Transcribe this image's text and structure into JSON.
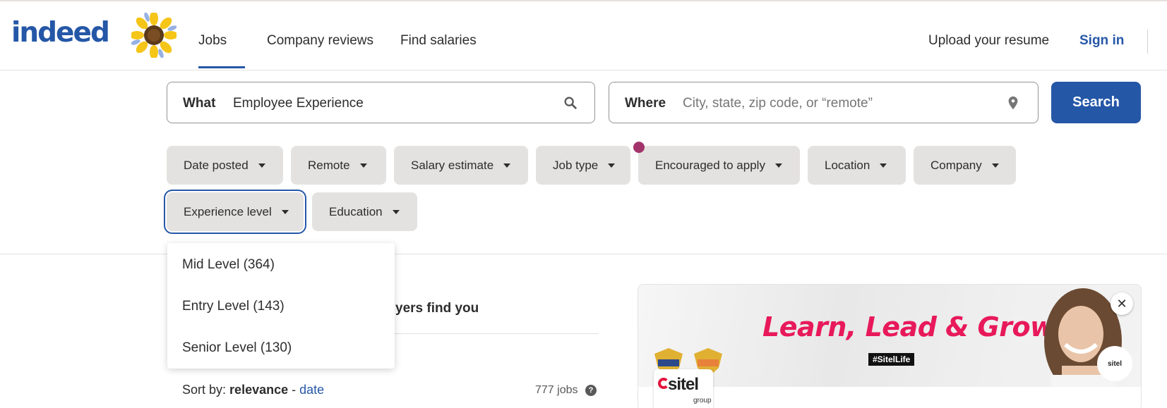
{
  "header": {
    "logo_text": "indeed",
    "nav": {
      "jobs": "Jobs",
      "company_reviews": "Company reviews",
      "find_salaries": "Find salaries"
    },
    "upload_resume": "Upload your resume",
    "sign_in": "Sign in"
  },
  "search": {
    "what_label": "What",
    "what_value": "Employee Experience",
    "where_label": "Where",
    "where_placeholder": "City, state, zip code, or “remote”",
    "button_label": "Search"
  },
  "filters": [
    {
      "label": "Date posted"
    },
    {
      "label": "Remote"
    },
    {
      "label": "Salary estimate"
    },
    {
      "label": "Job type"
    },
    {
      "label": "Encouraged to apply"
    },
    {
      "label": "Location"
    },
    {
      "label": "Company"
    },
    {
      "label": "Experience level",
      "active": true
    },
    {
      "label": "Education"
    }
  ],
  "experience_dropdown": {
    "options": [
      "Mid Level (364)",
      "Entry Level (143)",
      "Senior Level (130)"
    ]
  },
  "results": {
    "partial_heading": "yers find you",
    "sort_prefix": "Sort by:",
    "sort_relevance": "relevance",
    "sort_separator": " - ",
    "sort_date": "date",
    "job_count": "777 jobs"
  },
  "ad": {
    "title": "Learn, Lead & Grow",
    "hashtag": "#SitelLife",
    "company_logo_text": "sitel",
    "company_logo_sub": "group",
    "close_symbol": "✕"
  },
  "colors": {
    "brand_blue": "#2557a7",
    "filter_bg": "#e4e2e0",
    "notification_dot": "#a3336b",
    "ad_accent": "#e8195a"
  }
}
